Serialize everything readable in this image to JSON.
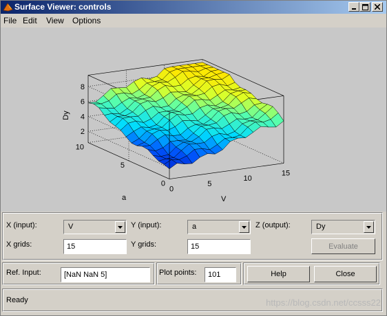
{
  "window": {
    "title": "Surface Viewer: controls"
  },
  "menu": [
    "File",
    "Edit",
    "View",
    "Options"
  ],
  "plot": {
    "zlabel": "Dy",
    "xlabel": "V",
    "ylabel": "a",
    "z_ticks": [
      "2",
      "4",
      "6",
      "8"
    ],
    "x_ticks": [
      "0",
      "5",
      "10",
      "15"
    ],
    "y_ticks": [
      "0",
      "5",
      "10"
    ]
  },
  "controls": {
    "x_input_label": "X (input):",
    "x_input_value": "V",
    "y_input_label": "Y (input):",
    "y_input_value": "a",
    "z_output_label": "Z (output):",
    "z_output_value": "Dy",
    "x_grids_label": "X grids:",
    "x_grids_value": "15",
    "y_grids_label": "Y grids:",
    "y_grids_value": "15",
    "evaluate_label": "Evaluate",
    "ref_input_label": "Ref. Input:",
    "ref_input_value": "[NaN NaN 5]",
    "plot_points_label": "Plot points:",
    "plot_points_value": "101",
    "help_label": "Help",
    "close_label": "Close"
  },
  "status": "Ready",
  "watermark": "https://blog.csdn.net/ccsss22"
}
